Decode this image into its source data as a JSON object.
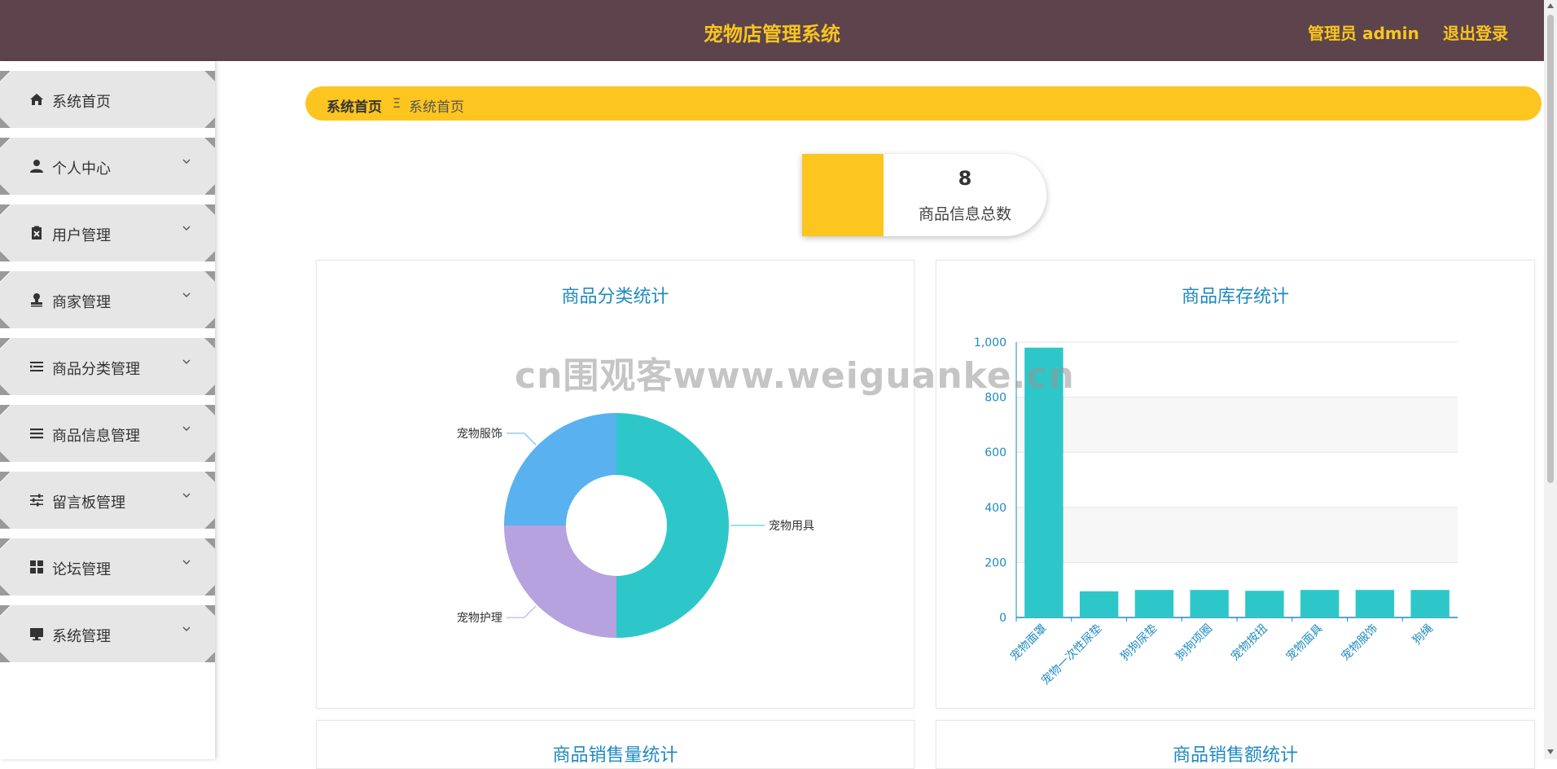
{
  "header": {
    "title": "宠物店管理系统",
    "admin_label": "管理员 admin",
    "logout_label": "退出登录"
  },
  "sidebar": {
    "items": [
      {
        "label": "系统首页",
        "icon": "home-icon",
        "has_chevron": false
      },
      {
        "label": "个人中心",
        "icon": "user-icon",
        "has_chevron": true
      },
      {
        "label": "用户管理",
        "icon": "clipboard-icon",
        "has_chevron": true
      },
      {
        "label": "商家管理",
        "icon": "stamp-icon",
        "has_chevron": true
      },
      {
        "label": "商品分类管理",
        "icon": "list-indent-icon",
        "has_chevron": true
      },
      {
        "label": "商品信息管理",
        "icon": "list-icon",
        "has_chevron": true
      },
      {
        "label": "留言板管理",
        "icon": "sliders-icon",
        "has_chevron": true
      },
      {
        "label": "论坛管理",
        "icon": "grid-icon",
        "has_chevron": true
      },
      {
        "label": "系统管理",
        "icon": "monitor-icon",
        "has_chevron": true
      }
    ]
  },
  "breadcrumb": {
    "home": "系统首页",
    "separator": "Ξ",
    "current": "系统首页"
  },
  "stat": {
    "value": "8",
    "label": "商品信息总数"
  },
  "panels": {
    "category_title": "商品分类统计",
    "stock_title": "商品库存统计",
    "sales_qty_title": "商品销售量统计",
    "sales_amount_title": "商品销售额统计"
  },
  "watermark": "cn围观客www.weiguanke.cn",
  "colors": {
    "header_bg": "#5d434c",
    "accent_yellow": "#fdc51f",
    "title_blue": "#1f8ac0",
    "teal": "#2ec7c9",
    "light_blue": "#5ab1ef",
    "lavender": "#b6a2de"
  },
  "chart_data": [
    {
      "type": "pie",
      "title": "商品分类统计",
      "donut": true,
      "slices": [
        {
          "label": "宠物用具",
          "value": 50,
          "color": "#2ec7c9"
        },
        {
          "label": "宠物护理",
          "value": 25,
          "color": "#b6a2de"
        },
        {
          "label": "宠物服饰",
          "value": 25,
          "color": "#5ab1ef"
        }
      ]
    },
    {
      "type": "bar",
      "title": "商品库存统计",
      "categories": [
        "宠物面罩",
        "宠物一次性尿垫",
        "狗狗尿垫",
        "狗狗项圈",
        "宠物按扭",
        "宠物面具",
        "宠物服饰",
        "狗绳"
      ],
      "values": [
        980,
        95,
        100,
        100,
        97,
        100,
        100,
        100
      ],
      "ylim": [
        0,
        1000
      ],
      "yticks": [
        0,
        200,
        400,
        600,
        800,
        1000
      ],
      "ytick_labels": [
        "0",
        "200",
        "400",
        "600",
        "800",
        "1,000"
      ],
      "bar_color": "#2ec7c9",
      "grid": true,
      "xlabel": "",
      "ylabel": ""
    }
  ]
}
